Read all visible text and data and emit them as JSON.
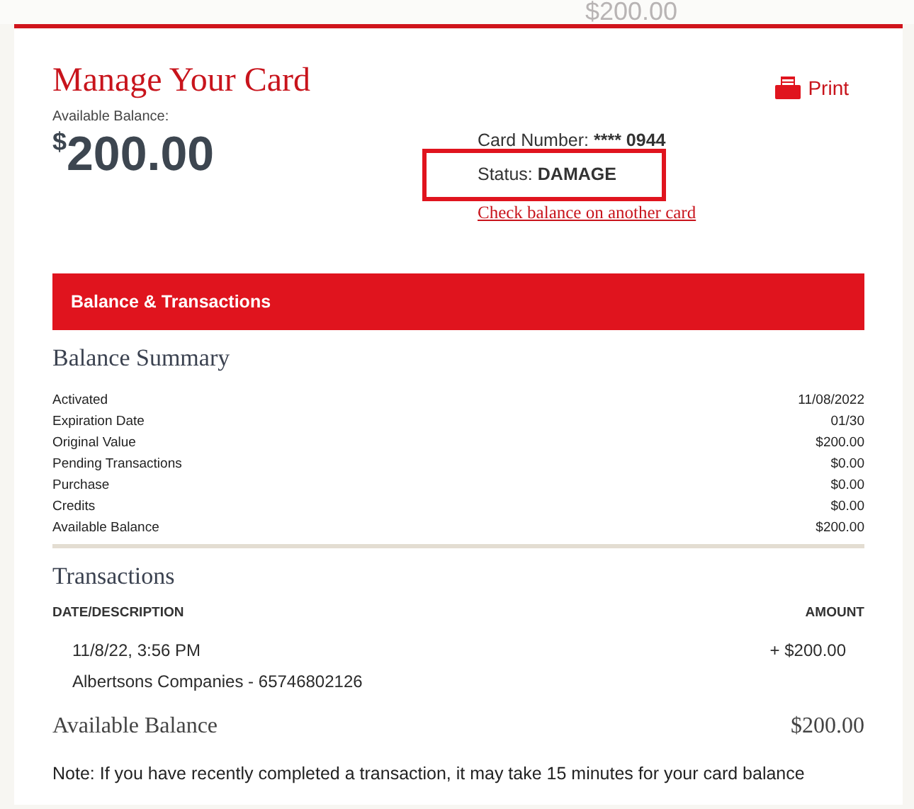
{
  "background_text": "$200.00",
  "title": "Manage Your Card",
  "print": {
    "label": "Print"
  },
  "balance": {
    "label": "Available Balance:",
    "currency": "$",
    "amount": "200.00"
  },
  "card_number": {
    "label": "Card Number:",
    "value": "**** 0944"
  },
  "status": {
    "label": "Status:",
    "value": "DAMAGE",
    "highlighted": true
  },
  "other_card_link": "Check balance on another card",
  "section_bar": "Balance & Transactions",
  "summary": {
    "heading": "Balance Summary",
    "rows": [
      {
        "label": "Activated",
        "value": "11/08/2022"
      },
      {
        "label": "Expiration Date",
        "value": "01/30"
      },
      {
        "label": "Original Value",
        "value": "$200.00"
      },
      {
        "label": "Pending Transactions",
        "value": "$0.00"
      },
      {
        "label": "Purchase",
        "value": "$0.00"
      },
      {
        "label": "Credits",
        "value": "$0.00"
      },
      {
        "label": "Available Balance",
        "value": "$200.00"
      }
    ]
  },
  "transactions": {
    "heading": "Transactions",
    "columns": [
      "DATE/DESCRIPTION",
      "AMOUNT"
    ],
    "rows": [
      {
        "date": "11/8/22, 3:56 PM",
        "description": "Albertsons Companies - 65746802126",
        "amount": "+ $200.00"
      }
    ]
  },
  "available": {
    "label": "Available Balance",
    "value": "$200.00"
  },
  "note": "Note: If you have recently completed a transaction, it may take 15 minutes for your card balance"
}
